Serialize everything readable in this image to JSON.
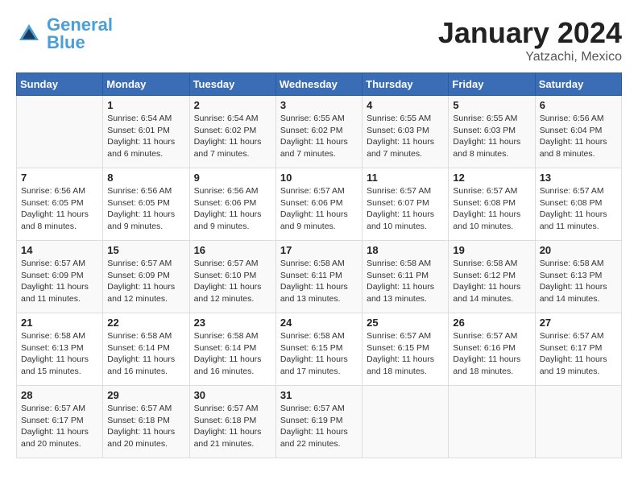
{
  "header": {
    "logo_text_general": "General",
    "logo_text_blue": "Blue",
    "month": "January 2024",
    "location": "Yatzachi, Mexico"
  },
  "days_of_week": [
    "Sunday",
    "Monday",
    "Tuesday",
    "Wednesday",
    "Thursday",
    "Friday",
    "Saturday"
  ],
  "weeks": [
    [
      {
        "num": "",
        "info": ""
      },
      {
        "num": "1",
        "info": "Sunrise: 6:54 AM\nSunset: 6:01 PM\nDaylight: 11 hours\nand 6 minutes."
      },
      {
        "num": "2",
        "info": "Sunrise: 6:54 AM\nSunset: 6:02 PM\nDaylight: 11 hours\nand 7 minutes."
      },
      {
        "num": "3",
        "info": "Sunrise: 6:55 AM\nSunset: 6:02 PM\nDaylight: 11 hours\nand 7 minutes."
      },
      {
        "num": "4",
        "info": "Sunrise: 6:55 AM\nSunset: 6:03 PM\nDaylight: 11 hours\nand 7 minutes."
      },
      {
        "num": "5",
        "info": "Sunrise: 6:55 AM\nSunset: 6:03 PM\nDaylight: 11 hours\nand 8 minutes."
      },
      {
        "num": "6",
        "info": "Sunrise: 6:56 AM\nSunset: 6:04 PM\nDaylight: 11 hours\nand 8 minutes."
      }
    ],
    [
      {
        "num": "7",
        "info": "Sunrise: 6:56 AM\nSunset: 6:05 PM\nDaylight: 11 hours\nand 8 minutes."
      },
      {
        "num": "8",
        "info": "Sunrise: 6:56 AM\nSunset: 6:05 PM\nDaylight: 11 hours\nand 9 minutes."
      },
      {
        "num": "9",
        "info": "Sunrise: 6:56 AM\nSunset: 6:06 PM\nDaylight: 11 hours\nand 9 minutes."
      },
      {
        "num": "10",
        "info": "Sunrise: 6:57 AM\nSunset: 6:06 PM\nDaylight: 11 hours\nand 9 minutes."
      },
      {
        "num": "11",
        "info": "Sunrise: 6:57 AM\nSunset: 6:07 PM\nDaylight: 11 hours\nand 10 minutes."
      },
      {
        "num": "12",
        "info": "Sunrise: 6:57 AM\nSunset: 6:08 PM\nDaylight: 11 hours\nand 10 minutes."
      },
      {
        "num": "13",
        "info": "Sunrise: 6:57 AM\nSunset: 6:08 PM\nDaylight: 11 hours\nand 11 minutes."
      }
    ],
    [
      {
        "num": "14",
        "info": "Sunrise: 6:57 AM\nSunset: 6:09 PM\nDaylight: 11 hours\nand 11 minutes."
      },
      {
        "num": "15",
        "info": "Sunrise: 6:57 AM\nSunset: 6:09 PM\nDaylight: 11 hours\nand 12 minutes."
      },
      {
        "num": "16",
        "info": "Sunrise: 6:57 AM\nSunset: 6:10 PM\nDaylight: 11 hours\nand 12 minutes."
      },
      {
        "num": "17",
        "info": "Sunrise: 6:58 AM\nSunset: 6:11 PM\nDaylight: 11 hours\nand 13 minutes."
      },
      {
        "num": "18",
        "info": "Sunrise: 6:58 AM\nSunset: 6:11 PM\nDaylight: 11 hours\nand 13 minutes."
      },
      {
        "num": "19",
        "info": "Sunrise: 6:58 AM\nSunset: 6:12 PM\nDaylight: 11 hours\nand 14 minutes."
      },
      {
        "num": "20",
        "info": "Sunrise: 6:58 AM\nSunset: 6:13 PM\nDaylight: 11 hours\nand 14 minutes."
      }
    ],
    [
      {
        "num": "21",
        "info": "Sunrise: 6:58 AM\nSunset: 6:13 PM\nDaylight: 11 hours\nand 15 minutes."
      },
      {
        "num": "22",
        "info": "Sunrise: 6:58 AM\nSunset: 6:14 PM\nDaylight: 11 hours\nand 16 minutes."
      },
      {
        "num": "23",
        "info": "Sunrise: 6:58 AM\nSunset: 6:14 PM\nDaylight: 11 hours\nand 16 minutes."
      },
      {
        "num": "24",
        "info": "Sunrise: 6:58 AM\nSunset: 6:15 PM\nDaylight: 11 hours\nand 17 minutes."
      },
      {
        "num": "25",
        "info": "Sunrise: 6:57 AM\nSunset: 6:15 PM\nDaylight: 11 hours\nand 18 minutes."
      },
      {
        "num": "26",
        "info": "Sunrise: 6:57 AM\nSunset: 6:16 PM\nDaylight: 11 hours\nand 18 minutes."
      },
      {
        "num": "27",
        "info": "Sunrise: 6:57 AM\nSunset: 6:17 PM\nDaylight: 11 hours\nand 19 minutes."
      }
    ],
    [
      {
        "num": "28",
        "info": "Sunrise: 6:57 AM\nSunset: 6:17 PM\nDaylight: 11 hours\nand 20 minutes."
      },
      {
        "num": "29",
        "info": "Sunrise: 6:57 AM\nSunset: 6:18 PM\nDaylight: 11 hours\nand 20 minutes."
      },
      {
        "num": "30",
        "info": "Sunrise: 6:57 AM\nSunset: 6:18 PM\nDaylight: 11 hours\nand 21 minutes."
      },
      {
        "num": "31",
        "info": "Sunrise: 6:57 AM\nSunset: 6:19 PM\nDaylight: 11 hours\nand 22 minutes."
      },
      {
        "num": "",
        "info": ""
      },
      {
        "num": "",
        "info": ""
      },
      {
        "num": "",
        "info": ""
      }
    ]
  ]
}
